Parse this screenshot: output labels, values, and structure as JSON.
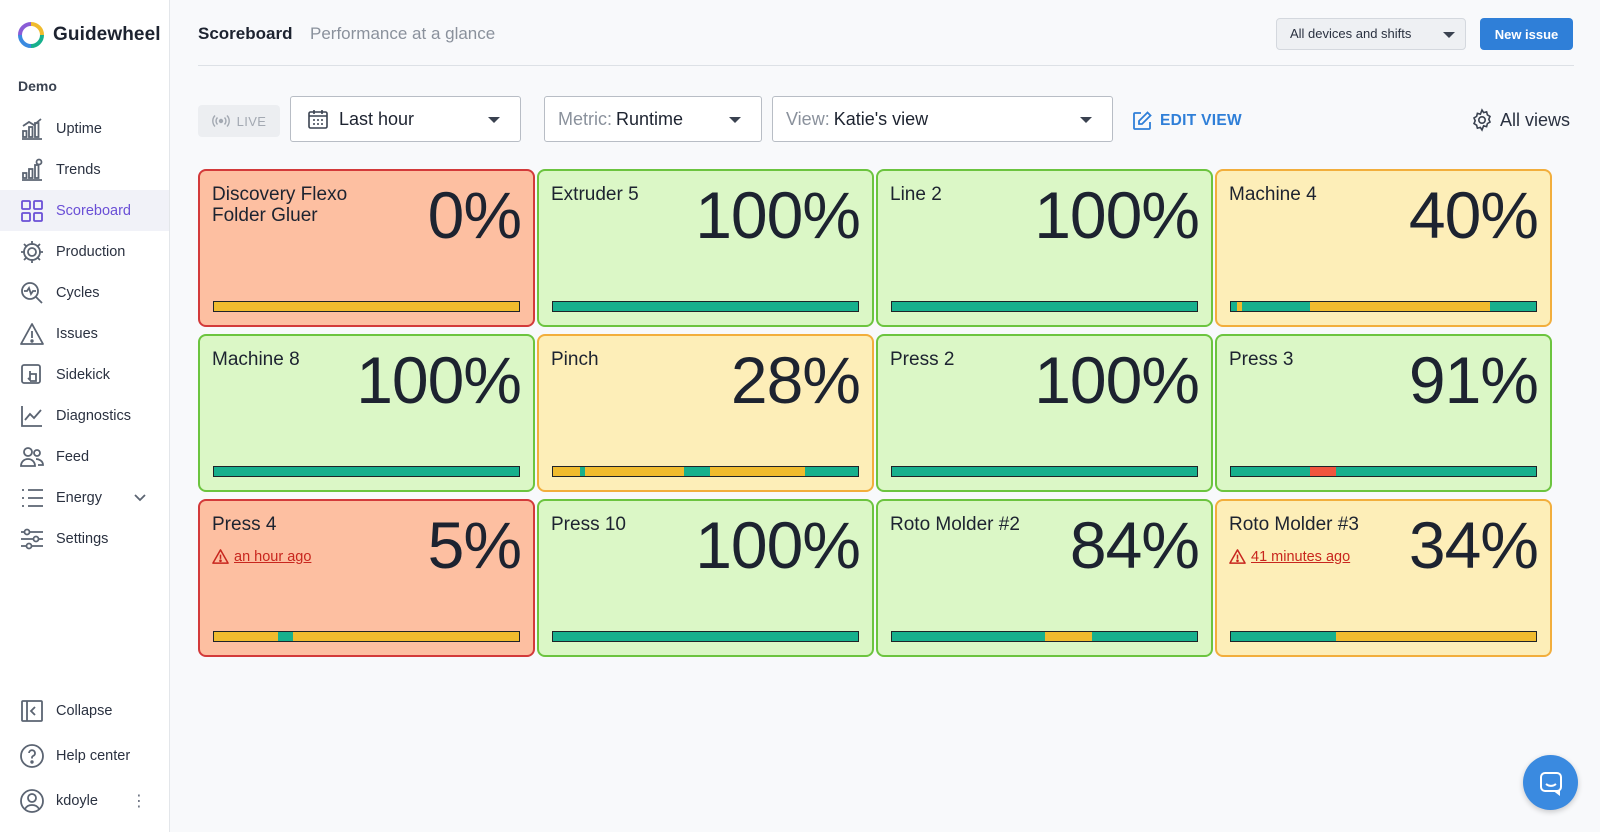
{
  "brand": {
    "name": "Guidewheel"
  },
  "workspace": "Demo",
  "nav": [
    {
      "key": "uptime",
      "label": "Uptime",
      "icon": "bar-chart-icon",
      "active": false
    },
    {
      "key": "trends",
      "label": "Trends",
      "icon": "trends-icon",
      "active": false
    },
    {
      "key": "scoreboard",
      "label": "Scoreboard",
      "icon": "grid-icon",
      "active": true
    },
    {
      "key": "production",
      "label": "Production",
      "icon": "gear-icon",
      "active": false
    },
    {
      "key": "cycles",
      "label": "Cycles",
      "icon": "magnifier-pulse-icon",
      "active": false
    },
    {
      "key": "issues",
      "label": "Issues",
      "icon": "warning-icon",
      "active": false
    },
    {
      "key": "sidekick",
      "label": "Sidekick",
      "icon": "touch-icon",
      "active": false
    },
    {
      "key": "diagnostics",
      "label": "Diagnostics",
      "icon": "line-chart-icon",
      "active": false
    },
    {
      "key": "feed",
      "label": "Feed",
      "icon": "users-icon",
      "active": false
    },
    {
      "key": "energy",
      "label": "Energy",
      "icon": "list-icon",
      "active": false
    },
    {
      "key": "settings",
      "label": "Settings",
      "icon": "sliders-icon",
      "active": false
    }
  ],
  "bottom_nav": {
    "collapse": "Collapse",
    "help": "Help center",
    "user": "kdoyle"
  },
  "header": {
    "title": "Scoreboard",
    "subtitle": "Performance at a glance",
    "device_filter": "All devices and shifts",
    "new_issue": "New issue"
  },
  "controls": {
    "live": "LIVE",
    "time_range": "Last hour",
    "metric_label": "Metric:",
    "metric_value": "Runtime",
    "view_label": "View:",
    "view_value": "Katie's view",
    "edit_view": "EDIT VIEW",
    "all_views": "All views"
  },
  "colors": {
    "run": "#17b08d",
    "idle": "#f0bb2e",
    "down": "#f0553e",
    "red_bg": "#fdbfa1",
    "green_bg": "#dbf7c6",
    "yellow_bg": "#fdeeb8"
  },
  "cards": [
    {
      "name": "Discovery Flexo Folder Gluer",
      "value": "0%",
      "status": "red",
      "alert": "",
      "timeline": [
        [
          "idle",
          1.0
        ]
      ]
    },
    {
      "name": "Extruder 5",
      "value": "100%",
      "status": "green",
      "alert": "",
      "timeline": [
        [
          "run",
          1.0
        ]
      ]
    },
    {
      "name": "Line 2",
      "value": "100%",
      "status": "green",
      "alert": "",
      "timeline": [
        [
          "run",
          1.0
        ]
      ]
    },
    {
      "name": "Machine 4",
      "value": "40%",
      "status": "yellow",
      "alert": "",
      "timeline": [
        [
          "run",
          0.02
        ],
        [
          "idle",
          0.015
        ],
        [
          "run",
          0.225
        ],
        [
          "idle",
          0.59
        ],
        [
          "run",
          0.15
        ]
      ]
    },
    {
      "name": "Machine 8",
      "value": "100%",
      "status": "green",
      "alert": "",
      "timeline": [
        [
          "run",
          1.0
        ]
      ]
    },
    {
      "name": "Pinch",
      "value": "28%",
      "status": "yellow",
      "alert": "",
      "timeline": [
        [
          "idle",
          0.09
        ],
        [
          "run",
          0.015
        ],
        [
          "idle",
          0.325
        ],
        [
          "run",
          0.085
        ],
        [
          "idle",
          0.31
        ],
        [
          "run",
          0.175
        ]
      ]
    },
    {
      "name": "Press 2",
      "value": "100%",
      "status": "green",
      "alert": "",
      "timeline": [
        [
          "run",
          1.0
        ]
      ]
    },
    {
      "name": "Press 3",
      "value": "91%",
      "status": "green",
      "alert": "",
      "timeline": [
        [
          "run",
          0.26
        ],
        [
          "down",
          0.085
        ],
        [
          "run",
          0.655
        ]
      ]
    },
    {
      "name": "Press 4",
      "value": "5%",
      "status": "red",
      "alert": "an hour ago",
      "timeline": [
        [
          "idle",
          0.21
        ],
        [
          "run",
          0.05
        ],
        [
          "idle",
          0.74
        ]
      ]
    },
    {
      "name": "Press 10",
      "value": "100%",
      "status": "green",
      "alert": "",
      "timeline": [
        [
          "run",
          1.0
        ]
      ]
    },
    {
      "name": "Roto Molder #2",
      "value": "84%",
      "status": "green",
      "alert": "",
      "timeline": [
        [
          "run",
          0.5
        ],
        [
          "idle",
          0.155
        ],
        [
          "run",
          0.345
        ]
      ]
    },
    {
      "name": "Roto Molder #3",
      "value": "34%",
      "status": "yellow",
      "alert": "41 minutes ago",
      "timeline": [
        [
          "run",
          0.345
        ],
        [
          "idle",
          0.655
        ]
      ]
    }
  ]
}
